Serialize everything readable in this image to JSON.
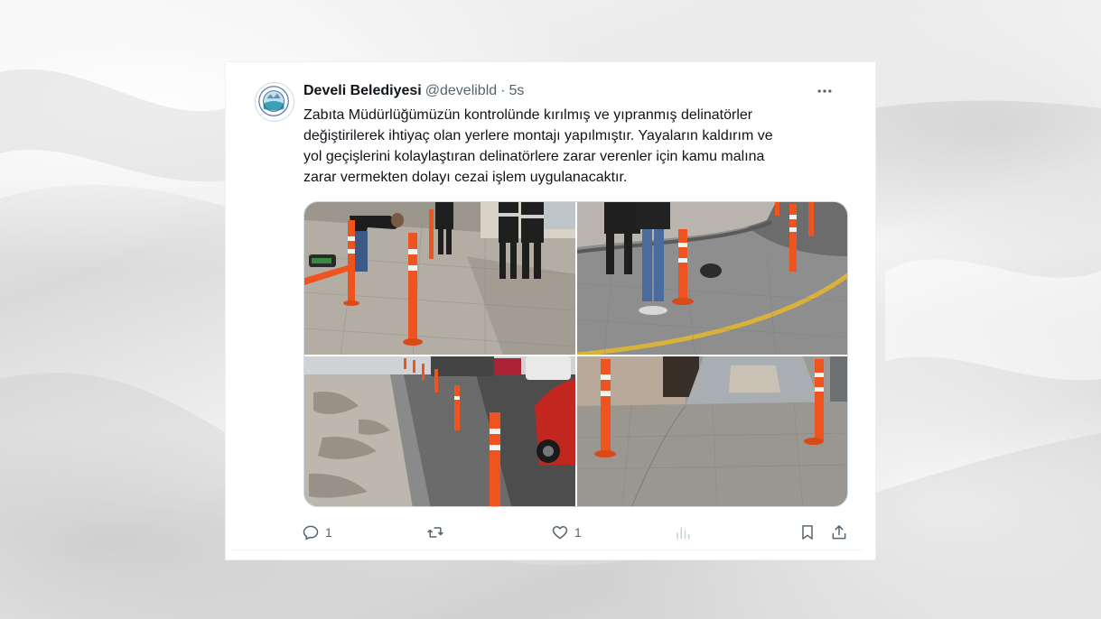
{
  "tweet": {
    "display_name": "Develi Belediyesi",
    "handle": "@develibld",
    "separator": "·",
    "time": "5s",
    "text_lines": [
      "Zabıta Müdürlüğümüzün kontrolünde kırılmış ve yıpranmış delinatörler",
      "değiştirilerek ihtiyaç olan yerlere montajı yapılmıştır. Yayaların kaldırım ve",
      "yol geçişlerini kolaylaştıran delinatörlere zarar verenler için kamu malına",
      "zarar vermekten dolayı cezai işlem uygulanacaktır."
    ],
    "media_count": 4
  },
  "actions": {
    "reply_icon": "reply-icon",
    "reply_count": "1",
    "retweet_icon": "retweet-icon",
    "retweet_count": "",
    "like_icon": "heart-icon",
    "like_count": "1",
    "views_icon": "views-icon",
    "bookmark_icon": "bookmark-icon",
    "share_icon": "share-icon"
  },
  "icons": {
    "more": "more-dots-icon",
    "avatar": "municipality-logo"
  },
  "colors": {
    "text_primary": "#0f1419",
    "text_secondary": "#536471",
    "bollard_orange": "#f0541e",
    "border": "#cfd9de"
  }
}
